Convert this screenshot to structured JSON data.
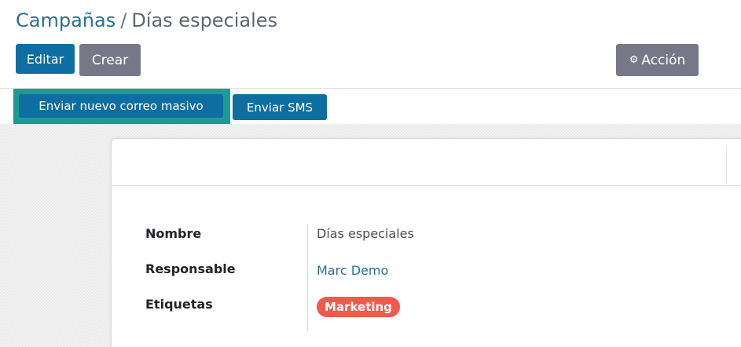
{
  "breadcrumb": {
    "parent": "Campañas",
    "separator": "/",
    "current": "Días especiales"
  },
  "toolbar": {
    "edit_label": "Editar",
    "create_label": "Crear",
    "action_label": "Acción",
    "action_icon": "gear-icon"
  },
  "header_buttons": {
    "mass_mail_label": "Enviar nuevo correo masivo",
    "sms_label": "Enviar SMS"
  },
  "form": {
    "fields": [
      {
        "label": "Nombre",
        "value": "Días especiales"
      },
      {
        "label": "Responsable",
        "value": "Marc Demo"
      },
      {
        "label": "Etiquetas",
        "value": "Marketing"
      }
    ]
  },
  "colors": {
    "primary": "#0f6ea1",
    "secondary": "#767888",
    "highlight": "#1a9c94",
    "tag": "#f0594c",
    "link": "#2a6f95"
  }
}
